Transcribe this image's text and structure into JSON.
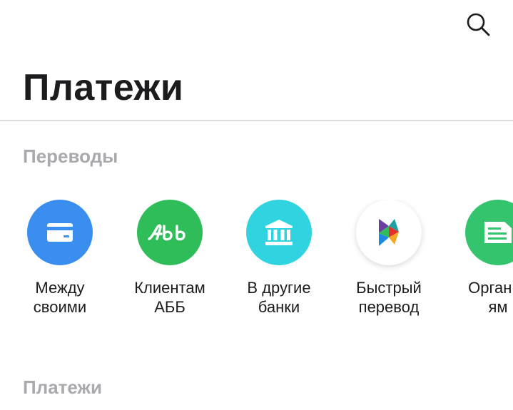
{
  "header": {
    "search_icon": "search-icon",
    "title": "Платежи"
  },
  "sections": {
    "transfers_title": "Переводы",
    "payments_title": "Платежи"
  },
  "transfers": [
    {
      "label": "Между\nсвоими",
      "color": "#3a8ef0",
      "icon": "card-icon"
    },
    {
      "label": "Клиентам\nАББ",
      "color": "#2fbd5a",
      "icon": "abb-logo-icon"
    },
    {
      "label": "В другие\nбанки",
      "color": "#2fd4e0",
      "icon": "bank-building-icon"
    },
    {
      "label": "Быстрый\nперевод",
      "color": "#ffffff",
      "icon": "fast-transfer-icon"
    },
    {
      "label": "Организ\nям",
      "color": "#35c46e",
      "icon": "document-icon"
    }
  ]
}
